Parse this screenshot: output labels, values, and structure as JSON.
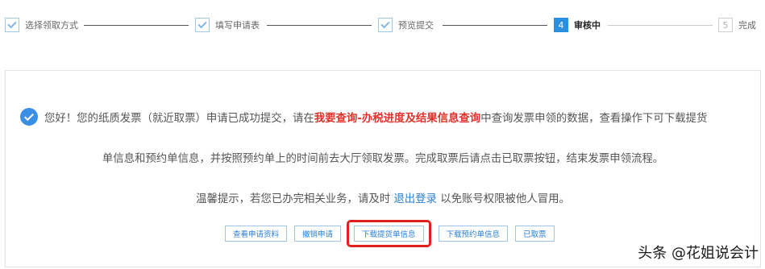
{
  "stepper": {
    "steps": [
      {
        "label": "选择领取方式",
        "state": "done"
      },
      {
        "label": "填写申请表",
        "state": "done"
      },
      {
        "label": "预览提交",
        "state": "done"
      },
      {
        "label": "审核中",
        "number": "4",
        "state": "active"
      },
      {
        "label": "完成",
        "number": "5",
        "state": "pending"
      }
    ]
  },
  "message": {
    "line1_prefix": "您好！您的纸质发票（就近取票）申请已成功提交，请在",
    "line1_link": "我要查询-办税进度及结果信息查询",
    "line1_suffix": "中查询发票申领的数据，查看操作下可下载提货",
    "line2": "单信息和预约单信息，并按照预约单上的时间前去大厅领取发票。完成取票后请点击已取票按钮，结束发票申领流程。",
    "line3_prefix": "温馨提示，若您已办完相关业务，请及时 ",
    "line3_link": "退出登录",
    "line3_suffix": " 以免账号权限被他人冒用。"
  },
  "buttons": {
    "view": "查看申请资料",
    "revoke": "撤销申请",
    "download_pickup": "下载提货单信息",
    "download_booking": "下载预约单信息",
    "picked": "已取票"
  },
  "watermark": "头条 @花姐说会计",
  "colors": {
    "accent": "#2b8fe0",
    "highlight": "#e1221c",
    "link_red": "#e0312a",
    "link_blue": "#2b7fd6"
  }
}
